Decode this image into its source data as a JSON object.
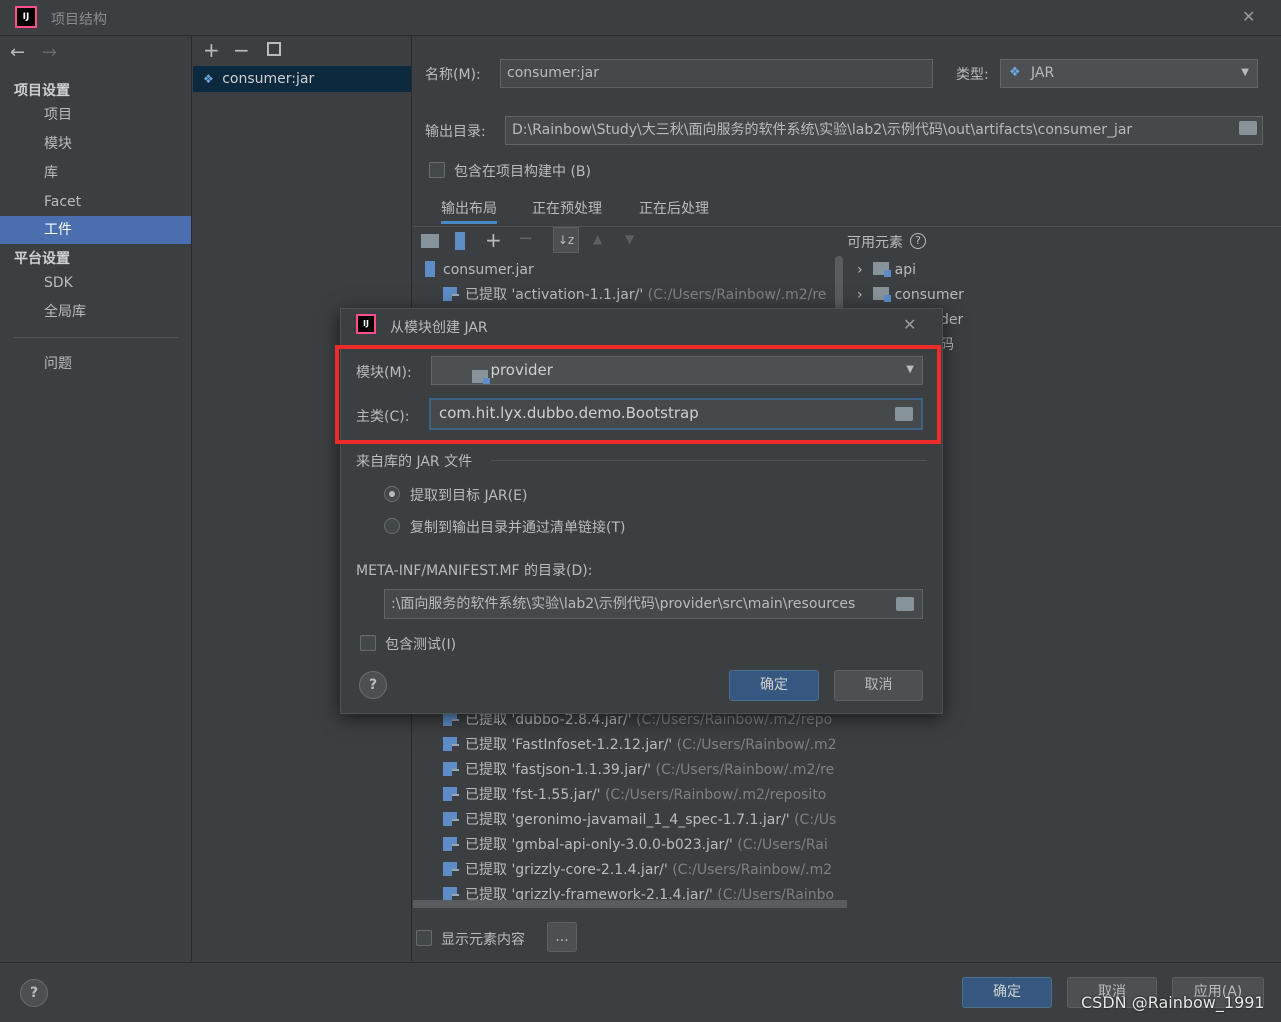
{
  "window": {
    "title": "项目结构"
  },
  "nav": {
    "back": "←",
    "forward": "→",
    "project_settings": "项目设置",
    "project": "项目",
    "modules": "模块",
    "libraries": "库",
    "facets": "Facet",
    "artifacts": "工件",
    "platform_settings": "平台设置",
    "sdk": "SDK",
    "global_libs": "全局库",
    "problems": "问题"
  },
  "artifact": {
    "name": "consumer:jar"
  },
  "form": {
    "name_label": "名称(M):",
    "name_value": "consumer:jar",
    "type_label": "类型:",
    "type_value": "JAR",
    "output_label": "输出目录:",
    "output_value": "D:\\Rainbow\\Study\\大三秋\\面向服务的软件系统\\实验\\lab2\\示例代码\\out\\artifacts\\consumer_jar",
    "include_build": "包含在项目构建中 (B)"
  },
  "tabs": [
    "输出布局",
    "正在预处理",
    "正在后处理"
  ],
  "available": {
    "label": "可用元素",
    "items": [
      "api",
      "consumer",
      "der",
      "码"
    ]
  },
  "tree": {
    "root": "consumer.jar",
    "rows_top": [
      {
        "name": "已提取 'activation-1.1.jar/'",
        "path": "(C:/Users/Rainbow/.m2/re"
      }
    ],
    "rows_bottom": [
      {
        "name": "已提取 'dubbo-2.8.4.jar/'",
        "path": "(C:/Users/Rainbow/.m2/repo"
      },
      {
        "name": "已提取 'FastInfoset-1.2.12.jar/'",
        "path": "(C:/Users/Rainbow/.m2"
      },
      {
        "name": "已提取 'fastjson-1.1.39.jar/'",
        "path": "(C:/Users/Rainbow/.m2/re"
      },
      {
        "name": "已提取 'fst-1.55.jar/'",
        "path": "(C:/Users/Rainbow/.m2/reposito"
      },
      {
        "name": "已提取 'geronimo-javamail_1_4_spec-1.7.1.jar/'",
        "path": "(C:/Us"
      },
      {
        "name": "已提取 'gmbal-api-only-3.0.0-b023.jar/'",
        "path": "(C:/Users/Rai"
      },
      {
        "name": "已提取 'grizzly-core-2.1.4.jar/'",
        "path": "(C:/Users/Rainbow/.m2"
      },
      {
        "name": "已提取 'grizzly-framework-2.1.4.jar/'",
        "path": "(C:/Users/Rainbo"
      }
    ]
  },
  "show_content": "显示元素内容",
  "ellipsis": "...",
  "dialog": {
    "title": "从模块创建 JAR",
    "module_label": "模块(M):",
    "module_value": "provider",
    "main_label": "主类(C):",
    "main_value": "com.hit.lyx.dubbo.demo.Bootstrap",
    "lib_section": "来自库的 JAR 文件",
    "opt_extract": "提取到目标 JAR(E)",
    "opt_copy": "复制到输出目录并通过清单链接(T)",
    "manifest_label": "META-INF/MANIFEST.MF 的目录(D):",
    "manifest_value": ":\\面向服务的软件系统\\实验\\lab2\\示例代码\\provider\\src\\main\\resources",
    "include_tests": "包含测试(I)",
    "ok": "确定",
    "cancel": "取消"
  },
  "footer": {
    "ok": "确定",
    "cancel": "取消",
    "apply": "应用(A)",
    "watermark": "CSDN @Rainbow_1991"
  },
  "help": "?",
  "close": "✕"
}
